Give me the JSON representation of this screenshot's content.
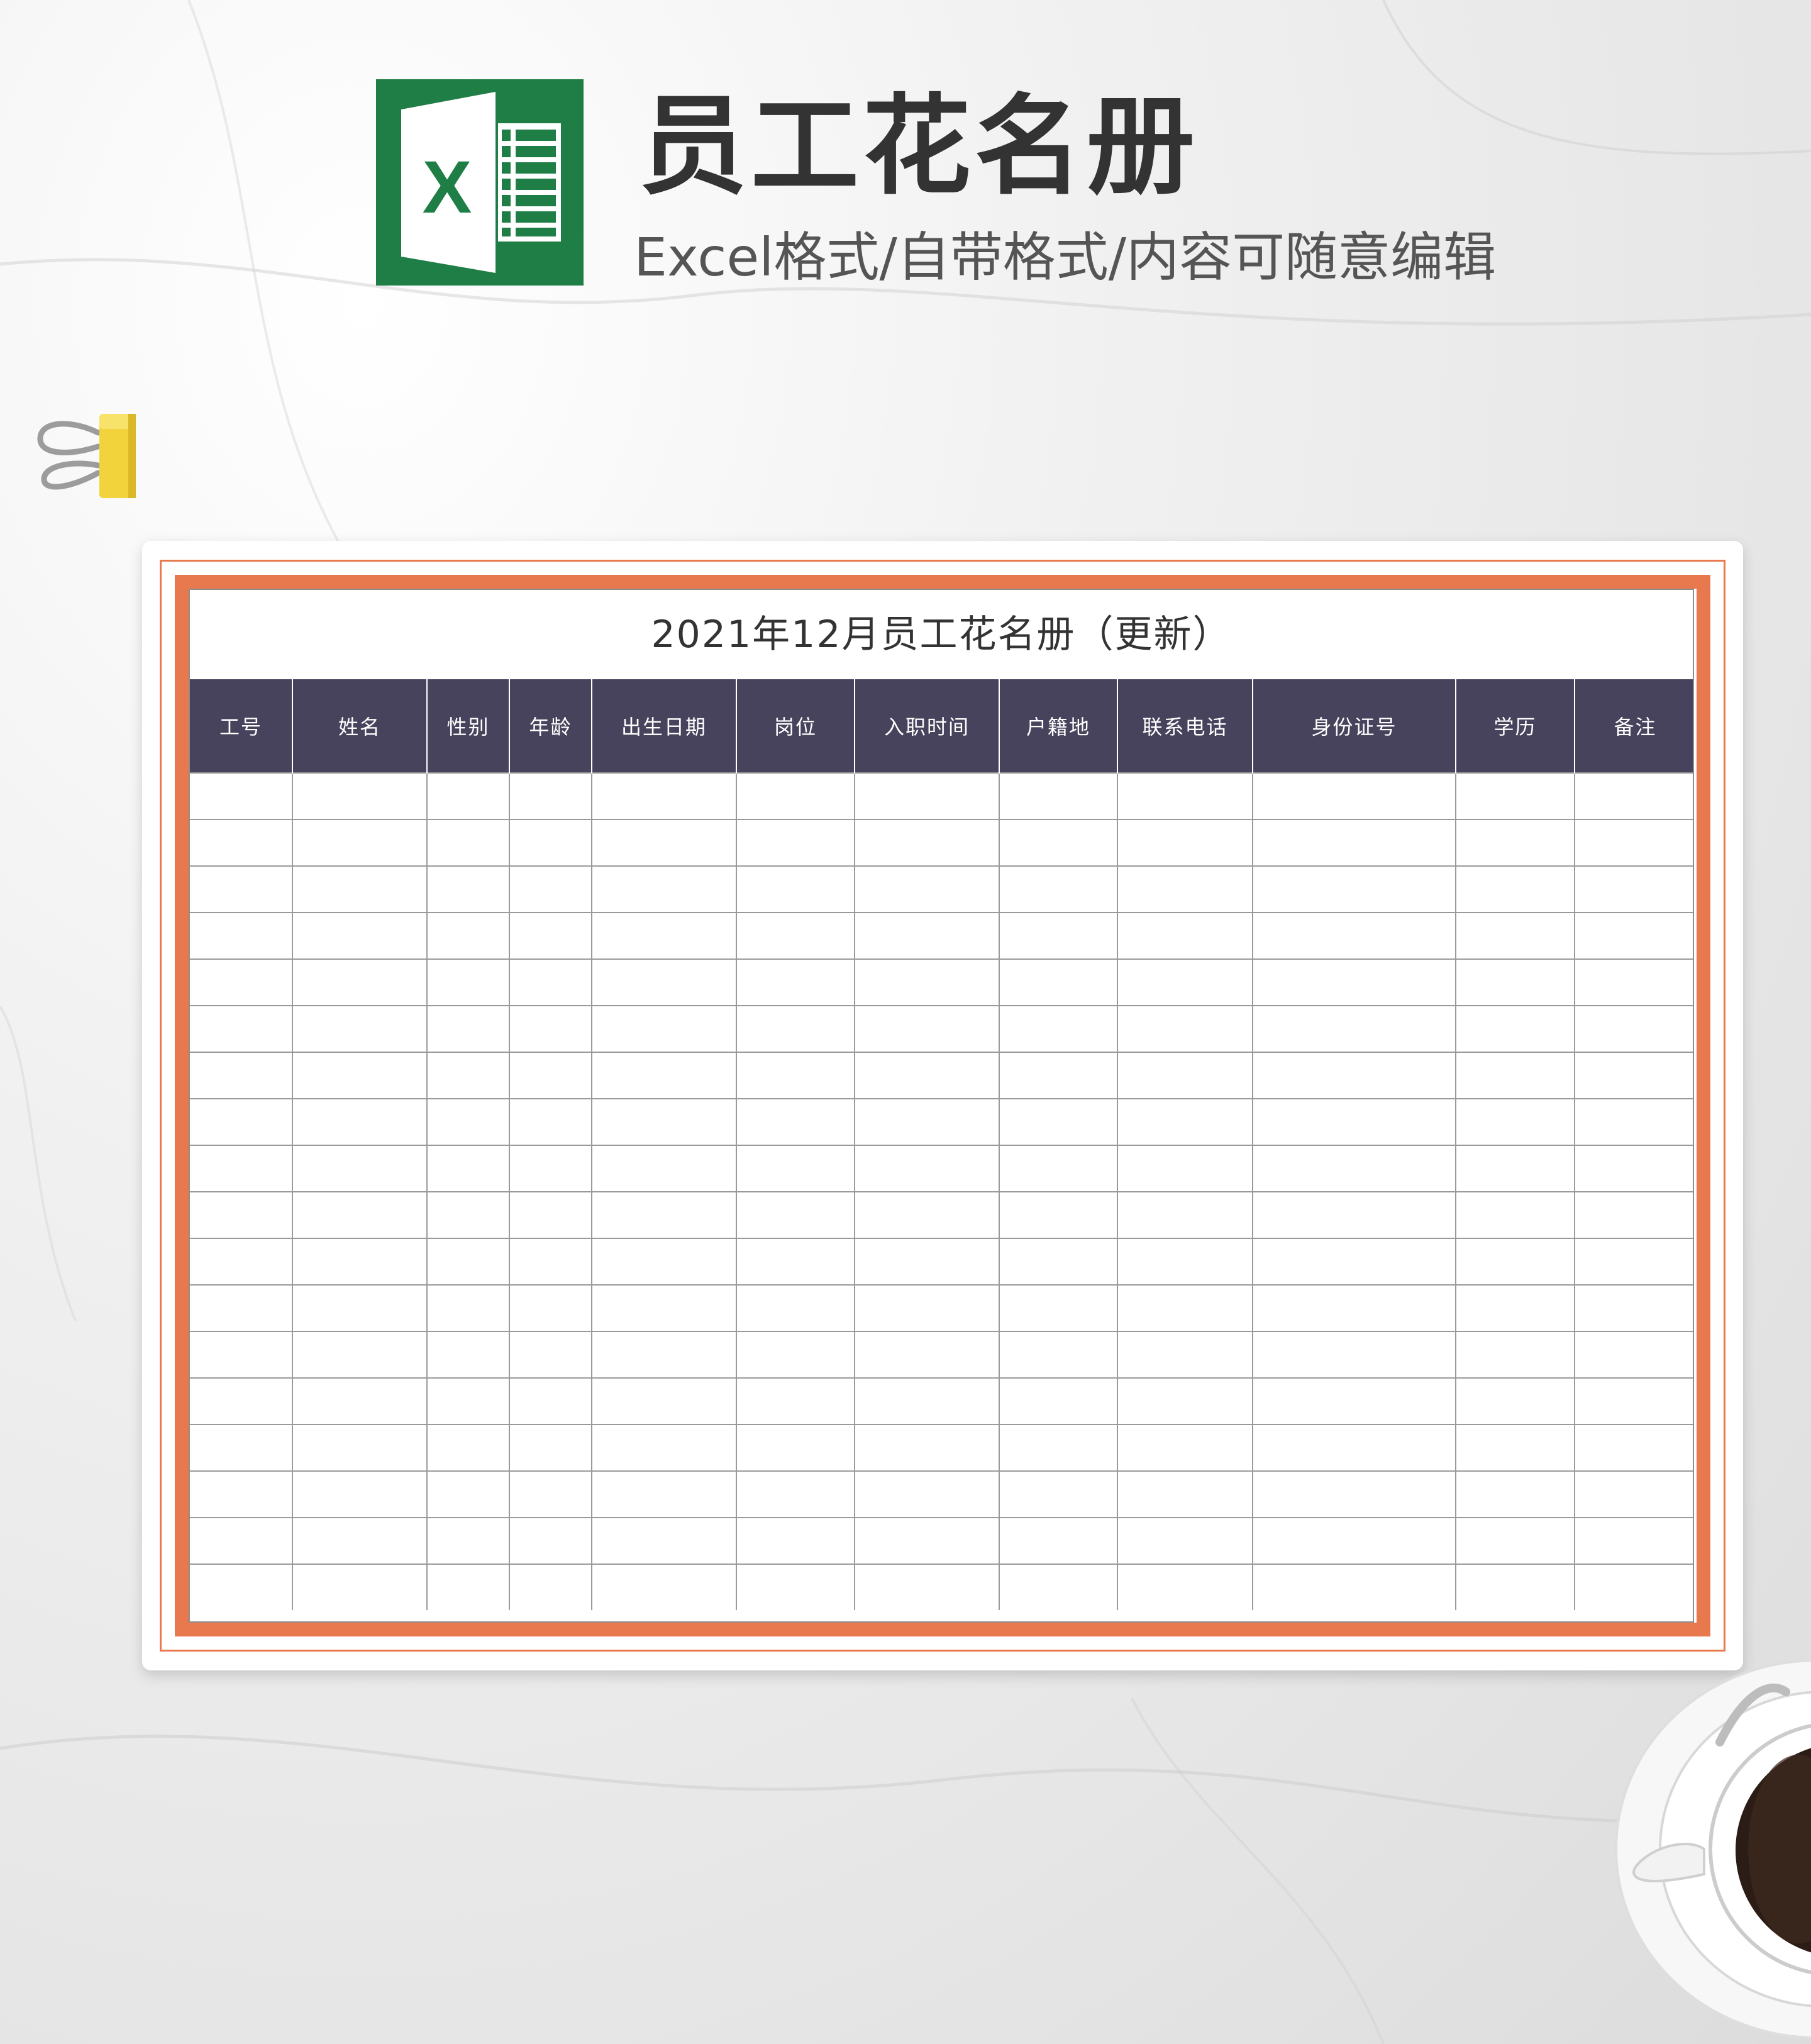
{
  "header": {
    "logo_icon": "excel-icon",
    "logo_letter": "X",
    "title": "员工花名册",
    "subtitle": "Excel格式/自带格式/内容可随意编辑"
  },
  "colors": {
    "excel_green": "#1e7e45",
    "frame_orange": "#e8784e",
    "header_fill": "#47435c",
    "grid_line": "#9a9a9a"
  },
  "decor": {
    "clip_icon": "binder-clip-icon",
    "cup_icon": "coffee-cup-icon"
  },
  "sheet": {
    "title": "2021年12月员工花名册（更新）",
    "columns": [
      "工号",
      "姓名",
      "性别",
      "年龄",
      "出生日期",
      "岗位",
      "入职时间",
      "户籍地",
      "联系电话",
      "身份证号",
      "学历",
      "备注"
    ],
    "blank_row_count": 18
  }
}
